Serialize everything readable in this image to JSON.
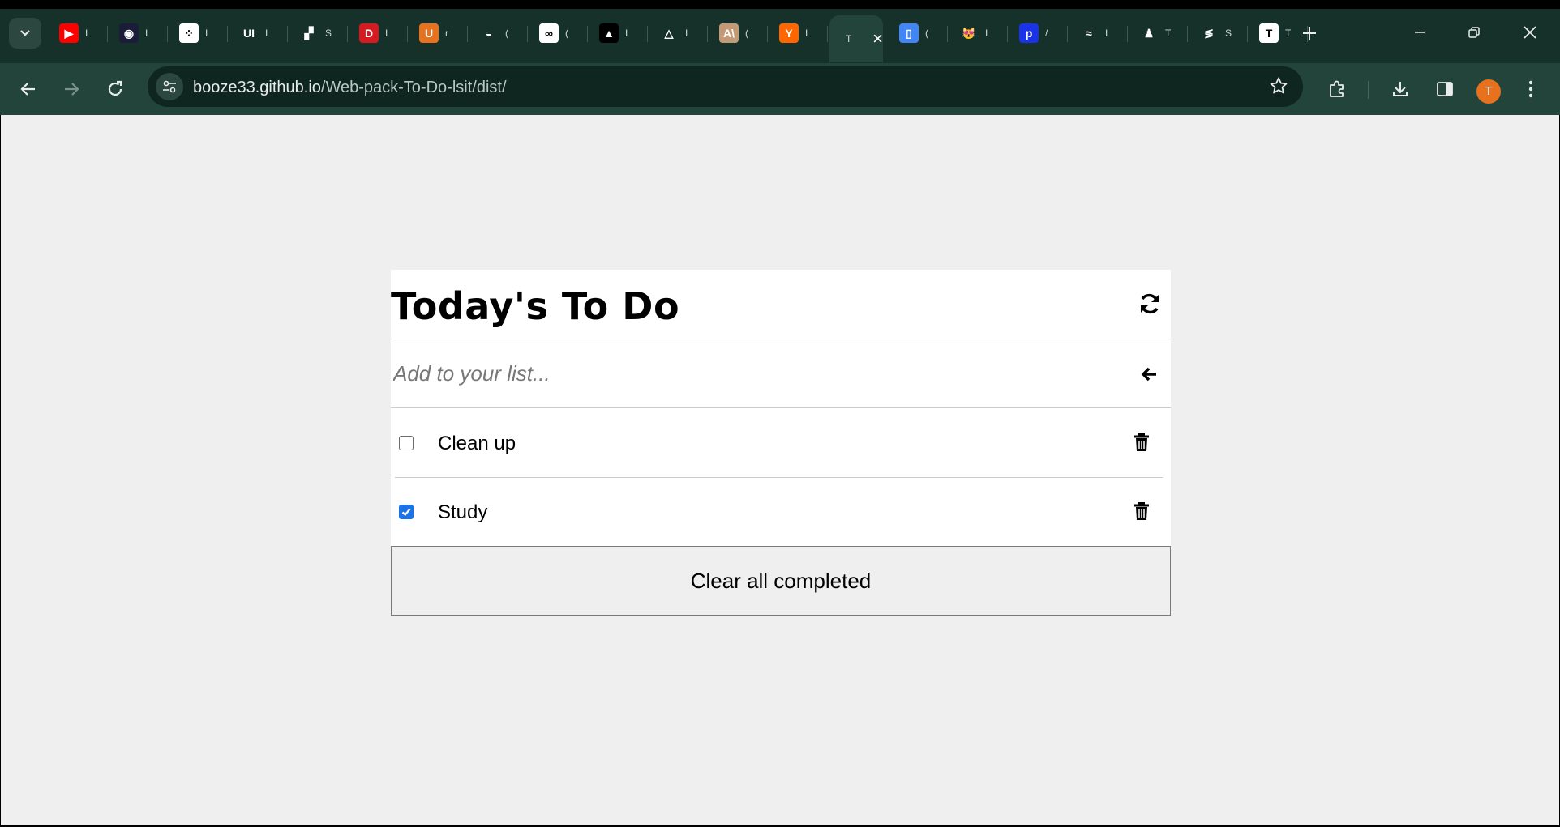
{
  "browser": {
    "tabs": [
      {
        "icon": "youtube-icon",
        "color": "#ff0000",
        "glyph": "▶",
        "label": "I"
      },
      {
        "icon": "color-wheel-icon",
        "color": "#1b1b3a",
        "glyph": "◉",
        "label": "I"
      },
      {
        "icon": "dots-grid-icon",
        "color": "#ffffff",
        "glyph": "⁘",
        "label": "I"
      },
      {
        "icon": "ui-logo-icon",
        "color": "#16312a",
        "glyph": "UI",
        "label": "I"
      },
      {
        "icon": "orange-blocks-icon",
        "color": "#16312a",
        "glyph": "▞",
        "label": "S"
      },
      {
        "icon": "d-logo-icon",
        "color": "#d71920",
        "glyph": "D",
        "label": "I"
      },
      {
        "icon": "u-logo-icon",
        "color": "#e8711e",
        "glyph": "U",
        "label": "r"
      },
      {
        "icon": "cup-icon",
        "color": "#16312a",
        "glyph": "◒",
        "label": "("
      },
      {
        "icon": "link-logo-icon",
        "color": "#ffffff",
        "glyph": "∞",
        "label": "("
      },
      {
        "icon": "triangle-logo-icon",
        "color": "#000000",
        "glyph": "▲",
        "label": "I"
      },
      {
        "icon": "google-drive-icon",
        "color": "#16312a",
        "glyph": "△",
        "label": "I"
      },
      {
        "icon": "anthropic-icon",
        "color": "#c49a76",
        "glyph": "A\\",
        "label": "("
      },
      {
        "icon": "y-combinator-icon",
        "color": "#ff6600",
        "glyph": "Y",
        "label": "I"
      },
      {
        "icon": "active-tab-icon",
        "color": "#22443a",
        "glyph": "",
        "label": "T"
      },
      {
        "icon": "docs-icon",
        "color": "#4285f4",
        "glyph": "▯",
        "label": "("
      },
      {
        "icon": "cat-emoji-icon",
        "color": "#16312a",
        "glyph": "😻",
        "label": "I"
      },
      {
        "icon": "p-logo-icon",
        "color": "#1a32e8",
        "glyph": "p",
        "label": "/"
      },
      {
        "icon": "tailwind-icon",
        "color": "#16312a",
        "glyph": "≈",
        "label": "I"
      },
      {
        "icon": "figure-icon",
        "color": "#16312a",
        "glyph": "♟",
        "label": "T"
      },
      {
        "icon": "stripe-s-icon",
        "color": "#16312a",
        "glyph": "≶",
        "label": "S"
      },
      {
        "icon": "t-logo-icon",
        "color": "#ffffff",
        "glyph": "T",
        "label": "T"
      }
    ],
    "address": {
      "host": "booze33.github.io",
      "path": "/Web-pack-To-Do-lsit/dist/"
    },
    "profile_initial": "T",
    "colors": {
      "frame": "#16312a",
      "toolbar": "#22443a",
      "omnibox": "#0f2620",
      "avatar": "#e8711e"
    }
  },
  "todo": {
    "title": "Today's To Do",
    "input_placeholder": "Add to your list...",
    "items": [
      {
        "text": "Clean up",
        "completed": false
      },
      {
        "text": "Study",
        "completed": true
      }
    ],
    "clear_button": "Clear all completed",
    "colors": {
      "background": "#efefef",
      "card": "#ffffff",
      "checkbox_checked": "#1a73e8"
    }
  }
}
